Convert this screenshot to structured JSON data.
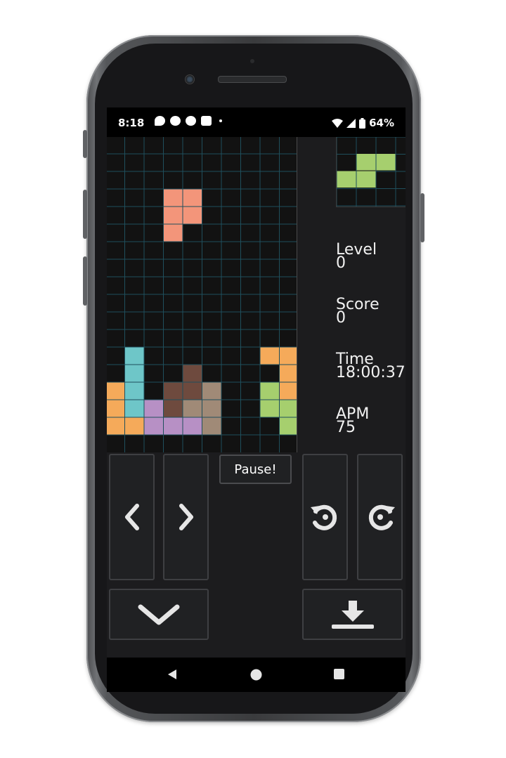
{
  "status_bar": {
    "time": "8:18",
    "notification_icons": [
      "chat-bubble-icon",
      "messenger-icon",
      "messenger-icon",
      "messenger-box-icon",
      "dot-icon"
    ],
    "battery": "64%"
  },
  "board": {
    "cols": 10,
    "rows": 16,
    "cell_colors": {
      "orange": "#f5aa5a",
      "cyan": "#6ec6c8",
      "purple": "#b790c5",
      "brown": "#6e4a3e",
      "taupe": "#a08a77",
      "green": "#a6cf6e",
      "salmon": "#f3957a"
    },
    "falling_piece": {
      "color": "salmon",
      "cells": [
        [
          3,
          4
        ],
        [
          4,
          4
        ],
        [
          3,
          5
        ],
        [
          4,
          5
        ],
        [
          3,
          6
        ]
      ]
    },
    "locked_cells": [
      {
        "c": 1,
        "r": 13,
        "color": "cyan"
      },
      {
        "c": 1,
        "r": 14,
        "color": "cyan"
      },
      {
        "c": 1,
        "r": 15,
        "color": "cyan"
      },
      {
        "c": 1,
        "r": 16,
        "color": "cyan"
      },
      {
        "c": 0,
        "r": 15,
        "color": "orange"
      },
      {
        "c": 0,
        "r": 16,
        "color": "orange"
      },
      {
        "c": 0,
        "r": 17,
        "color": "orange"
      },
      {
        "c": 1,
        "r": 17,
        "color": "orange"
      },
      {
        "c": 2,
        "r": 16,
        "color": "purple"
      },
      {
        "c": 2,
        "r": 17,
        "color": "purple"
      },
      {
        "c": 3,
        "r": 17,
        "color": "purple"
      },
      {
        "c": 4,
        "r": 17,
        "color": "purple"
      },
      {
        "c": 4,
        "r": 14,
        "color": "brown"
      },
      {
        "c": 3,
        "r": 15,
        "color": "brown"
      },
      {
        "c": 4,
        "r": 15,
        "color": "brown"
      },
      {
        "c": 3,
        "r": 16,
        "color": "brown"
      },
      {
        "c": 5,
        "r": 15,
        "color": "taupe"
      },
      {
        "c": 4,
        "r": 16,
        "color": "taupe"
      },
      {
        "c": 5,
        "r": 16,
        "color": "taupe"
      },
      {
        "c": 5,
        "r": 17,
        "color": "taupe"
      },
      {
        "c": 8,
        "r": 13,
        "color": "orange"
      },
      {
        "c": 9,
        "r": 13,
        "color": "orange"
      },
      {
        "c": 9,
        "r": 14,
        "color": "orange"
      },
      {
        "c": 9,
        "r": 15,
        "color": "orange"
      },
      {
        "c": 8,
        "r": 15,
        "color": "green"
      },
      {
        "c": 8,
        "r": 16,
        "color": "green"
      },
      {
        "c": 9,
        "r": 16,
        "color": "green"
      },
      {
        "c": 9,
        "r": 17,
        "color": "green"
      }
    ]
  },
  "next_piece": {
    "color": "green",
    "cells": [
      [
        1,
        1
      ],
      [
        2,
        1
      ],
      [
        0,
        2
      ],
      [
        1,
        2
      ]
    ]
  },
  "stats": {
    "level_label": "Level",
    "level_value": "0",
    "score_label": "Score",
    "score_value": "0",
    "time_label": "Time",
    "time_value": "18:00:37",
    "apm_label": "APM",
    "apm_value": "75"
  },
  "controls": {
    "pause_label": "Pause!",
    "left_icon": "chevron-left-icon",
    "right_icon": "chevron-right-icon",
    "rotate_ccw_icon": "rotate-counterclockwise-icon",
    "rotate_cw_icon": "rotate-clockwise-icon",
    "soft_drop_icon": "chevron-down-icon",
    "hard_drop_icon": "hard-drop-icon"
  },
  "nav_bar": {
    "back_icon": "back-triangle-icon",
    "home_icon": "home-circle-icon",
    "recents_icon": "recents-square-icon"
  }
}
